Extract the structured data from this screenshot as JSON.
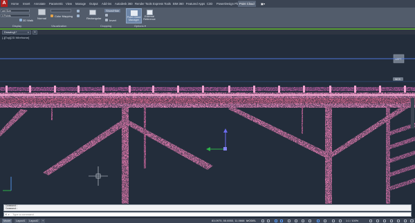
{
  "ribbon_tabs": [
    "Home",
    "Insert",
    "Annotate",
    "Parametric",
    "View",
    "Manage",
    "Output",
    "Add-ins",
    "Autodesk 360",
    "Render Tools",
    "Express Tools",
    "BIM 360",
    "Featured Apps",
    "C3D",
    "PowerDesign Plant",
    "Point Cloud"
  ],
  "active_tab": "Point Cloud",
  "ribbon": {
    "display_field_1": "ant Size",
    "display_field_2": "ll Points",
    "walk_label": "3D Walk",
    "normal_label": "Normal",
    "color_mapping_label": "Color Mapping",
    "rectangular_label": "Rectangular",
    "show_hide_label": "Show/Hide",
    "invert_label": "Invert",
    "pcm_label_1": "Point Cloud",
    "pcm_label_2": "Manager",
    "ext_label_1": "External",
    "ext_label_2": "Reference",
    "panel_display": "Display",
    "panel_visualization": "Visualization",
    "panel_cropping": "Cropping",
    "panel_options": "Options ▾"
  },
  "file_tab": "Drawing1*",
  "new_tab_symbol": "+",
  "viewport_label": "[-][Top][2D Wireframe]",
  "viewcube_label": "LEFT",
  "nav_label": "WCS",
  "command_history": [
    "Command:",
    "Command:"
  ],
  "command_placeholder": "Type a command",
  "layout_tabs": [
    "Model",
    "Layout1",
    "Layout2"
  ],
  "status": {
    "coordinates": "83.0975, 55.6553, 11.0668",
    "model_label": "MODEL",
    "scale": "1:1 / 100%"
  },
  "colors": {
    "canvas_bg": "#232d3b",
    "point_cloud_primary": "#f08ac0",
    "point_cloud_secondary": "#c45070",
    "accent_green": "#5fa43b",
    "blue_line": "#4f78d8"
  }
}
